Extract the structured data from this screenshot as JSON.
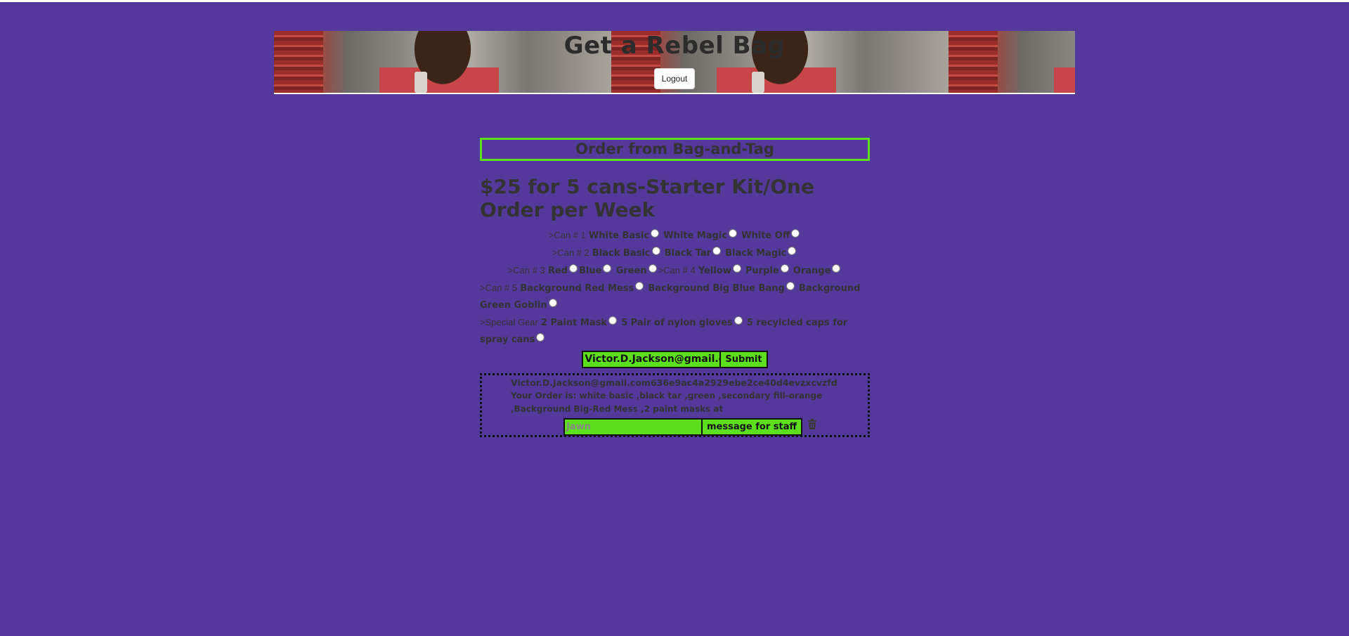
{
  "header": {
    "title": "Get a Rebel Bag",
    "logout_label": "Logout"
  },
  "order": {
    "title": "Order from Bag-and-Tag",
    "price_heading": "$25 for 5 cans-Starter Kit/One Order per Week",
    "can1": {
      "label": ">Can # 1",
      "options": [
        "White Basic",
        "White Magic",
        "White Off"
      ]
    },
    "can2": {
      "label": ">Can # 2",
      "options": [
        "Black Basic",
        "Black Tar",
        "Black Magic"
      ]
    },
    "can3": {
      "label": ">Can # 3",
      "options": [
        "Red",
        "Blue",
        "Green"
      ]
    },
    "can4": {
      "label": ">Can # 4",
      "options": [
        "Yellow",
        "Purple",
        "Orange"
      ]
    },
    "can5": {
      "label": ">Can # 5",
      "options": [
        "Background Red Mess",
        "Background Big Blue Bang",
        "Background Green Goblin"
      ]
    },
    "gear": {
      "label": ">Special Gear",
      "options": [
        "2 Paint Mask",
        "5 Pair of nylon gloves",
        "5 recyicled caps for spray cans"
      ]
    },
    "email_value": "Victor.D.Jackson@gmail.com",
    "submit_label": "Submit"
  },
  "placed_order": {
    "email_line": "Victor.D.Jackson@gmail.com636e9ac4a2929ebe2ce40d4evzxcvzfd",
    "order_line": "Your Order is: white basic ,black tar ,green ,secondary fill-orange ,Background Big-Red Mess ,2 paint masks at",
    "message_placeholder": "Jawn",
    "message_button_label": "message for staff"
  },
  "icons": {
    "delete": "trash-icon"
  },
  "colors": {
    "background": "#55389b",
    "accent_green": "#5ce01d",
    "text": "#333333"
  }
}
